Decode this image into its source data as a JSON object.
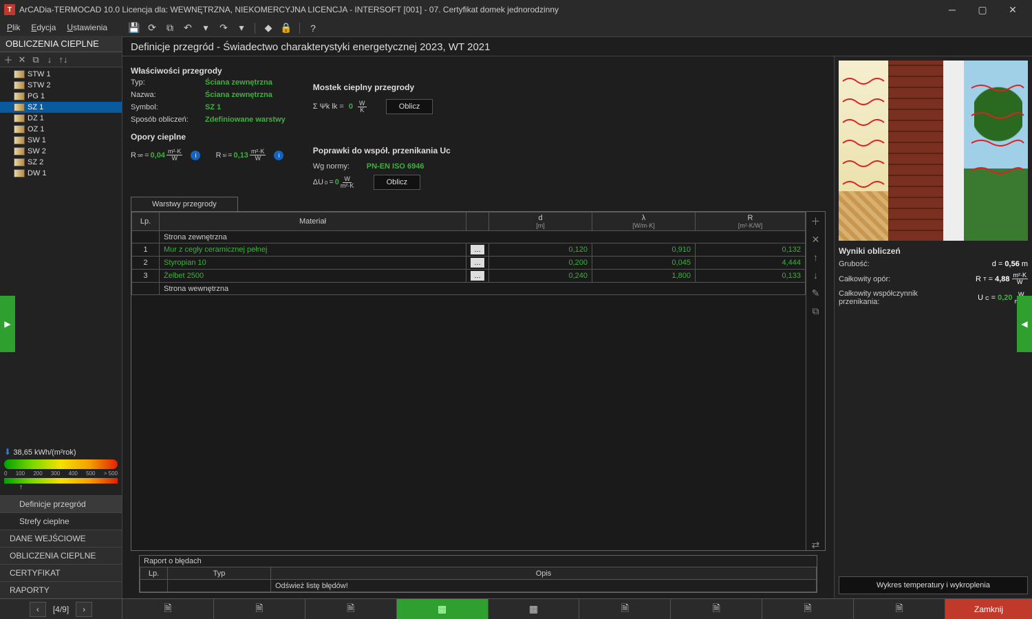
{
  "title": "ArCADia-TERMOCAD 10.0 Licencja dla: WEWNĘTRZNA, NIEKOMERCYJNA LICENCJA - INTERSOFT [001] - 07. Certyfikat domek jednorodzinny",
  "menu": {
    "file": "Plik",
    "edit": "Edycja",
    "settings": "Ustawienia"
  },
  "section_title": "OBLICZENIA CIEPLNE",
  "tree": {
    "items": [
      "STW 1",
      "STW 2",
      "PG 1",
      "SZ 1",
      "DZ 1",
      "OZ 1",
      "SW 1",
      "SW 2",
      "SZ 2",
      "DW 1"
    ],
    "selected": "SZ 1"
  },
  "energy": {
    "value": "38,65 kWh/(m²rok)",
    "ticks": [
      "0",
      "100",
      "200",
      "300",
      "400",
      "500",
      "> 500"
    ]
  },
  "nav": {
    "def": "Definicje przegród",
    "strefy": "Strefy cieplne",
    "dane": "DANE WEJŚCIOWE",
    "obl": "OBLICZENIA CIEPLNE",
    "cert": "CERTYFIKAT",
    "rap": "RAPORTY"
  },
  "header": "Definicje przegród - Świadectwo charakterystyki energetycznej 2023, WT 2021",
  "props": {
    "section": "Właściwości przegrody",
    "typ_l": "Typ:",
    "typ_v": "Ściana zewnętrzna",
    "nazwa_l": "Nazwa:",
    "nazwa_v": "Ściana zewnętrzna",
    "symbol_l": "Symbol:",
    "symbol_v": "SZ 1",
    "sposob_l": "Sposób obliczeń:",
    "sposob_v": "Zdefiniowane warstwy",
    "opory_h": "Opory cieplne",
    "rse_l": "Rse =",
    "rse_v": "0,04",
    "rsi_l": "Rsi =",
    "rsi_v": "0,13",
    "mostek_h": "Mostek cieplny przegrody",
    "mostek_eq": "Σ Ψk lk =",
    "mostek_v": "0",
    "oblicz": "Oblicz",
    "poprawki_h": "Poprawki do współ. przenikania Uc",
    "wg_l": "Wg normy:",
    "wg_v": "PN-EN ISO 6946",
    "du_l": "ΔU0 =",
    "du_v": "0"
  },
  "tab": "Warstwy przegrody",
  "cols": {
    "lp": "Lp.",
    "mat": "Materiał",
    "d": "d",
    "d_u": "[m]",
    "l": "λ",
    "l_u": "[W/m·K]",
    "r": "R",
    "r_u": "[m²·K/W]"
  },
  "rows": {
    "outer": "Strona zewnętrzna",
    "inner": "Strona wewnętrzna",
    "r1": {
      "lp": "1",
      "mat": "Mur z cegły ceramicznej pełnej",
      "d": "0,120",
      "l": "0,910",
      "r": "0,132"
    },
    "r2": {
      "lp": "2",
      "mat": "Styropian 10",
      "d": "0,200",
      "l": "0,045",
      "r": "4,444"
    },
    "r3": {
      "lp": "3",
      "mat": "Żelbet 2500",
      "d": "0,240",
      "l": "1,800",
      "r": "0,133"
    }
  },
  "results": {
    "h": "Wyniki obliczeń",
    "grub_l": "Grubość:",
    "grub_v": "0,56",
    "grub_u": "m",
    "opor_l": "Całkowity opór:",
    "opor_v": "4,88",
    "uc_l": "Całkowity współczynnik przenikania:",
    "uc_v": "0,20",
    "chart_btn": "Wykres temperatury i wykroplenia"
  },
  "err": {
    "h": "Raport o błędach",
    "lp": "Lp.",
    "typ": "Typ",
    "opis": "Opis",
    "msg": "Odśwież listę błędów!"
  },
  "pager": "[4/9]",
  "close": "Zamknij",
  "units": {
    "wk": "W",
    "wk2": "K",
    "m2k": "m²·K",
    "w": "W",
    "m2kw": "m²·K/W"
  }
}
